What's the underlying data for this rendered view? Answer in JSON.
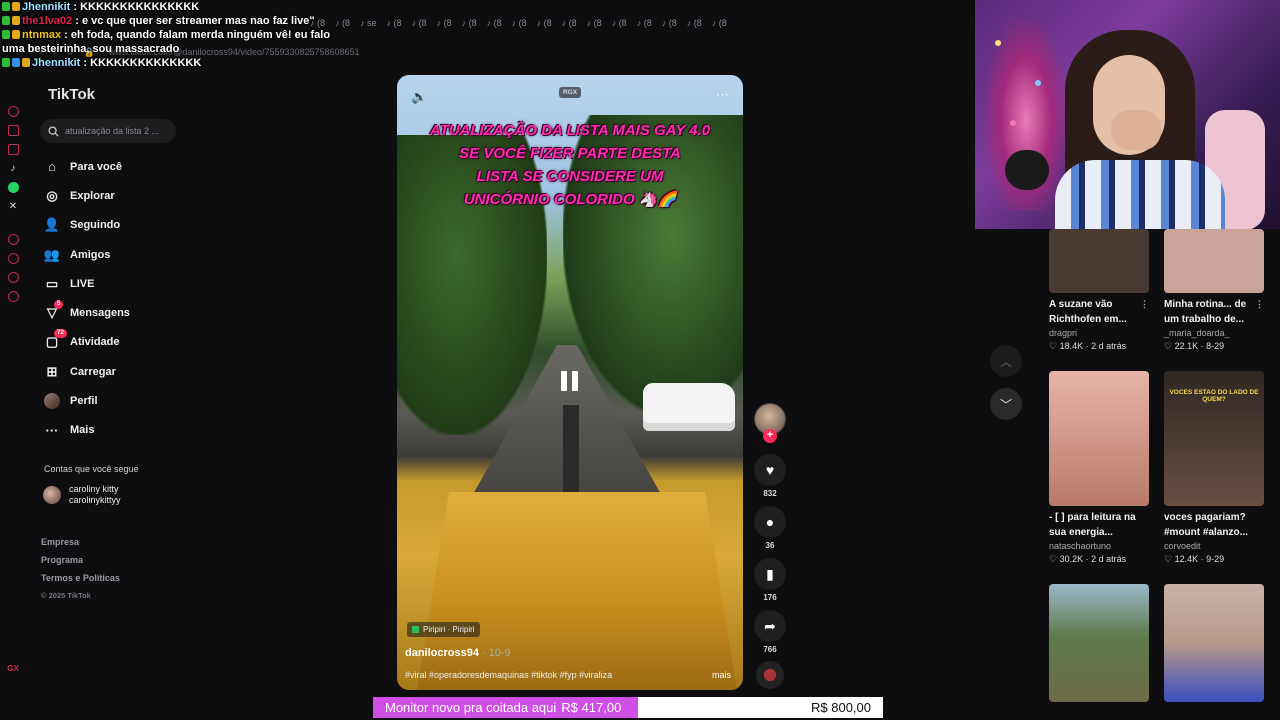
{
  "colors": {
    "accent": "#fe2c55",
    "donation_fill": "#d050e6",
    "video_text": "#ff2bb0",
    "chat_user_red": "#e0204a",
    "chat_user_gold": "#f0c419"
  },
  "chat": [
    {
      "user": "Jhennikit",
      "sep": " : ",
      "text": "KKKKKKKKKKKKKKK",
      "user_color": "#9be3ff"
    },
    {
      "user": "the1lva02",
      "sep": " : ",
      "text": "e vc que quer ser streamer mas nao faz live\"",
      "user_color": "#e0204a"
    },
    {
      "user": "ntnmax",
      "sep": " : ",
      "text": "eh foda, quando falam merda ninguém vê! eu falo uma besteirinha, sou massacrado",
      "user_color": "#f0c419"
    },
    {
      "user": "Jhennikit",
      "sep": " : ",
      "text": "KKKKKKKKKKKKKK",
      "user_color": "#9be3ff"
    }
  ],
  "browser": {
    "url": "www.tiktok.com/@danilocross94/video/7559330825758608651"
  },
  "tiktok": {
    "logo": "TikTok",
    "search_placeholder": "atualização da lista 2 ...",
    "nav": [
      {
        "label": "Para você",
        "icon": "home-icon",
        "glyph": "⌂"
      },
      {
        "label": "Explorar",
        "icon": "compass-icon",
        "glyph": "◎"
      },
      {
        "label": "Seguindo",
        "icon": "following-icon",
        "glyph": "👤"
      },
      {
        "label": "Amigos",
        "icon": "friends-icon",
        "glyph": "👥"
      },
      {
        "label": "LIVE",
        "icon": "live-icon",
        "glyph": "▭"
      },
      {
        "label": "Mensagens",
        "icon": "messages-icon",
        "glyph": "▽",
        "badge": "5"
      },
      {
        "label": "Atividade",
        "icon": "activity-icon",
        "glyph": "▢",
        "badge": "72"
      },
      {
        "label": "Carregar",
        "icon": "upload-icon",
        "glyph": "⊞"
      },
      {
        "label": "Perfil",
        "icon": "profile-icon",
        "glyph": ""
      },
      {
        "label": "Mais",
        "icon": "more-icon",
        "glyph": "···"
      }
    ],
    "follows_title": "Contas que você segue",
    "follow": {
      "name": "caroliny kitty",
      "handle": "carolinykittyy"
    },
    "footer": [
      "Empresa",
      "Programa",
      "Termos e Políticas"
    ],
    "copyright": "© 2025 TikTok"
  },
  "video": {
    "badge": "RGX",
    "overlay": [
      "ATUALIZAÇÃO DA LISTA MAIS GAY 4.0",
      "SE VOCÊ FIZER PARTE DESTA",
      "LISTA SE CONSIDERE UM",
      "UNICÓRNIO COLORIDO 🦄🌈"
    ],
    "location": "Piripiri · Piripiri",
    "author": "danilocross94",
    "date": "· 10-9",
    "caption": "#viral #operadoresdemaquinas #tiktok #fyp #viraliza",
    "more": "mais",
    "likes": "832",
    "comments": "36",
    "saves": "176",
    "shares": "766"
  },
  "grid": [
    {
      "title": "A suzane vão Richthofen em...",
      "author": "dragpri",
      "likes": "18.4K",
      "when": "2 d atrás",
      "thumb": "#4a3a34",
      "thumb_text": ""
    },
    {
      "title": "Minha rotina... de um trabalho de...",
      "author": "_maria_doarda_",
      "likes": "22.1K",
      "when": "8-29",
      "thumb": "#caa49a",
      "thumb_text": ""
    },
    {
      "title": "- [ ] para leitura na sua energia...",
      "author": "nataschaortuno",
      "likes": "30.2K",
      "when": "2 d atrás",
      "thumb": "#d8a79a",
      "thumb_text": ""
    },
    {
      "title": "voces pagariam? #mount #alanzo...",
      "author": "corvoedit",
      "likes": "12.4K",
      "when": "9-29",
      "thumb": "#3a3230",
      "thumb_text": "VOCES ESTAO DO LADO DE QUEM?"
    },
    {
      "title": "",
      "author": "",
      "likes": "",
      "when": "",
      "thumb": "#5d7a4a",
      "thumb_text": ""
    },
    {
      "title": "",
      "author": "",
      "likes": "",
      "when": "",
      "thumb": "#b89a8a",
      "thumb_text": ""
    }
  ],
  "donation": {
    "label": "Monitor novo pra coitada aqui",
    "current": "R$ 417,00",
    "goal": "R$ 800,00",
    "progress": 0.52
  }
}
